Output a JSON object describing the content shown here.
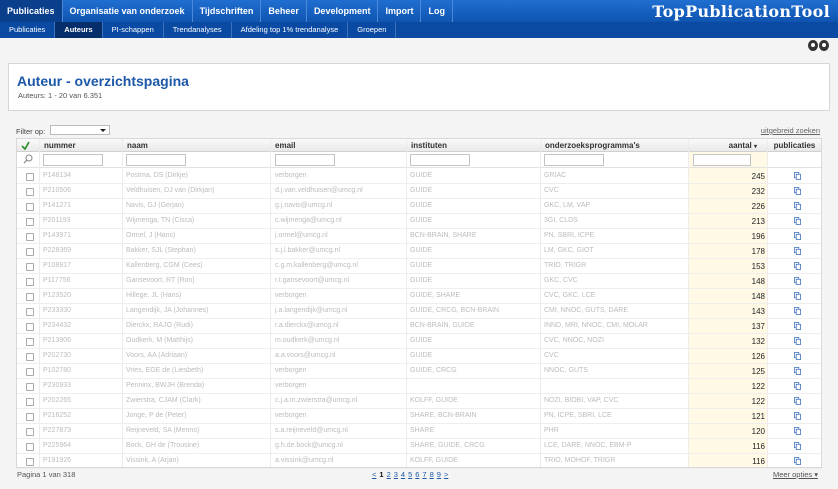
{
  "nav": {
    "brand": "TopPublicationTool",
    "top_items": [
      "Publicaties",
      "Organisatie van onderzoek",
      "Tijdschriften",
      "Beheer",
      "Development",
      "Import",
      "Log"
    ],
    "sub_items": [
      "Publicaties",
      "Auteurs",
      "PI-schappen",
      "Trendanalyses",
      "Afdeling top 1% trendanalyse",
      "Groepen"
    ]
  },
  "page": {
    "title": "Auteur - overzichtspagina",
    "subtitle": "Auteurs: 1 - 20 van 6.351"
  },
  "filter": {
    "label": "Filter op:",
    "selected": "",
    "advanced_link": "uitgebreid zoeken"
  },
  "table": {
    "columns": [
      "nummer",
      "naam",
      "email",
      "instituten",
      "onderzoeksprogramma's",
      "aantal",
      "publicaties"
    ],
    "rows": [
      {
        "nummer": "P148134",
        "naam": "Postma, DS (Dirkje)",
        "email": "verborgen",
        "instituten": "GUIDE",
        "programmas": "GRIAC",
        "aantal": "245"
      },
      {
        "nummer": "P210506",
        "naam": "Veldhuisen, DJ van (Dirkjan)",
        "email": "d.j.van.veldhuisen@umcg.nl",
        "instituten": "GUIDE",
        "programmas": "CVC",
        "aantal": "232"
      },
      {
        "nummer": "P141271",
        "naam": "Navis, GJ (Gerjan)",
        "email": "g.j.navis@umcg.nl",
        "instituten": "GUIDE",
        "programmas": "GKC, LM, VAP",
        "aantal": "226"
      },
      {
        "nummer": "P201193",
        "naam": "Wijmenga, TN (Cisca)",
        "email": "c.wijmenga@umcg.nl",
        "instituten": "GUIDE",
        "programmas": "3GI, CLDS",
        "aantal": "213"
      },
      {
        "nummer": "P143971",
        "naam": "Ormel, J (Hans)",
        "email": "j.ormel@umcg.nl",
        "instituten": "BCN-BRAIN, SHARE",
        "programmas": "PN, SBRI, ICPE",
        "aantal": "196"
      },
      {
        "nummer": "P228369",
        "naam": "Bakker, SJL (Stephan)",
        "email": "s.j.l.bakker@umcg.nl",
        "instituten": "GUIDE",
        "programmas": "LM, GKC, GIOT",
        "aantal": "178"
      },
      {
        "nummer": "P108917",
        "naam": "Kallenberg, CGM (Cees)",
        "email": "c.g.m.kallenberg@umcg.nl",
        "instituten": "GUIDE",
        "programmas": "TRIO, TRIGR",
        "aantal": "153"
      },
      {
        "nummer": "P117756",
        "naam": "Gansevoort, RT (Ron)",
        "email": "r.t.gansevoort@umcg.nl",
        "instituten": "GUIDE",
        "programmas": "GKC, CVC",
        "aantal": "148"
      },
      {
        "nummer": "P123520",
        "naam": "Hillege, JL (Hans)",
        "email": "verborgen",
        "instituten": "GUIDE, SHARE",
        "programmas": "CVC, GKC, LCE",
        "aantal": "148"
      },
      {
        "nummer": "P233330",
        "naam": "Langendijk, JA (Johannes)",
        "email": "j.a.langendijk@umcg.nl",
        "instituten": "GUIDE, CRCG, BCN-BRAIN",
        "programmas": "CMI, NNOC, GUTS, DARE",
        "aantal": "143"
      },
      {
        "nummer": "P234432",
        "naam": "Dierckx, RAJO (Rudi)",
        "email": "r.a.dierckx@umcg.nl",
        "instituten": "BCN-BRAIN, GUIDE",
        "programmas": "INND, MRI, NNOC, CMI, MOLAR",
        "aantal": "137"
      },
      {
        "nummer": "P213906",
        "naam": "Oudkerk, M (Matthijs)",
        "email": "m.oudkerk@umcg.nl",
        "instituten": "GUIDE",
        "programmas": "CVC, NNOC, NOZI",
        "aantal": "132"
      },
      {
        "nummer": "P202730",
        "naam": "Voors, AA (Adriaan)",
        "email": "a.a.voors@umcg.nl",
        "instituten": "GUIDE",
        "programmas": "CVC",
        "aantal": "126"
      },
      {
        "nummer": "P102780",
        "naam": "Vries, EGE de (Liesbeth)",
        "email": "verborgen",
        "instituten": "GUIDE, CRCG",
        "programmas": "NNOC, GUTS",
        "aantal": "125"
      },
      {
        "nummer": "P230933",
        "naam": "Penninx, BWJH (Brenda)",
        "email": "verborgen",
        "instituten": "",
        "programmas": "",
        "aantal": "122"
      },
      {
        "nummer": "P202265",
        "naam": "Zwierstra, CJAM (Clark)",
        "email": "c.j.a.m.zwierstra@umcg.nl",
        "instituten": "KOLFF, GUIDE",
        "programmas": "NOZI, BIOBI, VAP, CVC",
        "aantal": "122"
      },
      {
        "nummer": "P216252",
        "naam": "Jonge, P de (Peter)",
        "email": "verborgen",
        "instituten": "SHARE, BCN-BRAIN",
        "programmas": "PN, ICPE, SBRI, LCE",
        "aantal": "121"
      },
      {
        "nummer": "P227873",
        "naam": "Reijneveld, SA (Menno)",
        "email": "s.a.reijneveld@umcg.nl",
        "instituten": "SHARE",
        "programmas": "PHR",
        "aantal": "120"
      },
      {
        "nummer": "P225964",
        "naam": "Bock, GH de (Trousine)",
        "email": "g.h.de.bock@umcg.nl",
        "instituten": "SHARE, GUIDE, CRCG",
        "programmas": "LCE, DARE, NNOC, EBM-P",
        "aantal": "116"
      },
      {
        "nummer": "P191926",
        "naam": "Vissink, A (Arjan)",
        "email": "a.vissink@umcg.nl",
        "instituten": "KOLFF, GUIDE",
        "programmas": "TRIO, MOHOF, TRIGR",
        "aantal": "116"
      }
    ]
  },
  "footer": {
    "page_info": "Pagina 1 van 318",
    "pager": [
      "<",
      "1",
      "2",
      "3",
      "4",
      "5",
      "6",
      "7",
      "8",
      "9",
      ">"
    ],
    "meer": "Meer opties ▾"
  }
}
